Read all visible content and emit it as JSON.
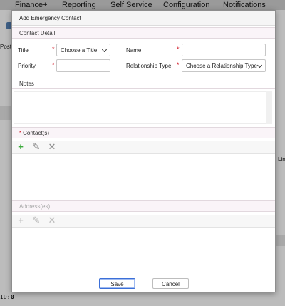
{
  "background": {
    "nav": [
      "Finance+",
      "Reporting",
      "Self Service",
      "Configuration",
      "Notifications"
    ],
    "frag_left": "Post S",
    "frag_right": "Lin",
    "frag_bottom_label": "ID:",
    "frag_bottom_value": "0"
  },
  "dialog": {
    "title": "Add Emergency Contact",
    "contact_detail": {
      "header": "Contact Detail",
      "title_label": "Title",
      "title_value": "Choose a Title",
      "name_label": "Name",
      "name_value": "",
      "priority_label": "Priority",
      "priority_value": "",
      "relationship_label": "Relationship Type",
      "relationship_value": "Choose a Relationship Type",
      "required_mark": "*"
    },
    "notes": {
      "header": "Notes",
      "value": ""
    },
    "contacts": {
      "header": "Contact(s)",
      "required_mark": "*",
      "add_icon": "+",
      "edit_icon": "✎",
      "delete_icon": "✕"
    },
    "addresses": {
      "header": "Address(es)",
      "add_icon": "+",
      "edit_icon": "✎",
      "delete_icon": "✕"
    },
    "buttons": {
      "save": "Save",
      "cancel": "Cancel"
    }
  },
  "colors": {
    "required": "#d0101f",
    "add_icon": "#3cab3c",
    "primary_border": "#3b6fd8"
  }
}
